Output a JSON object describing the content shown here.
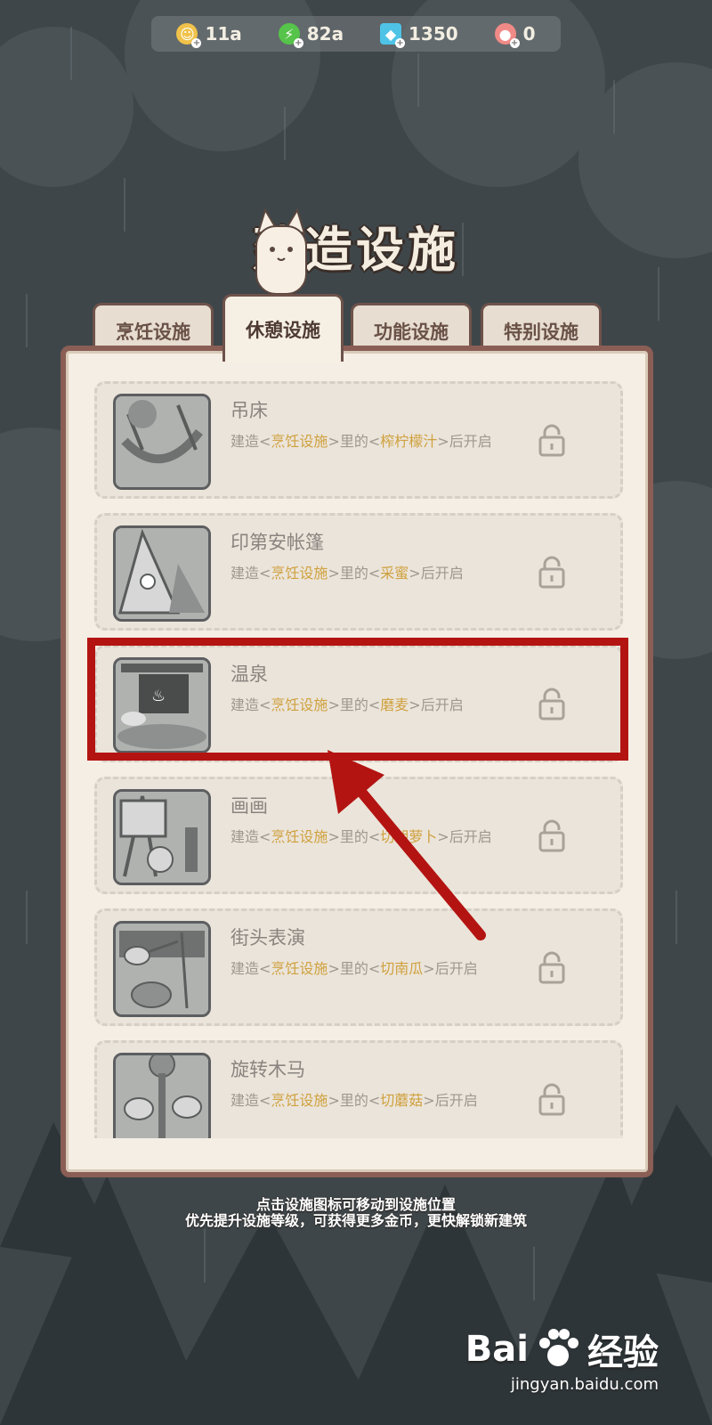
{
  "currencies": [
    {
      "icon": "coin-icon",
      "value": "11a",
      "color": "#f0c24a"
    },
    {
      "icon": "energy-icon",
      "value": "82a",
      "color": "#56c44a"
    },
    {
      "icon": "diamond-icon",
      "value": "1350",
      "color": "#4fc3e6"
    },
    {
      "icon": "donut-icon",
      "value": "0",
      "color": "#f08a86"
    }
  ],
  "title": "建造设施",
  "tabs": [
    {
      "label": "烹饪设施",
      "active": false
    },
    {
      "label": "休憩设施",
      "active": true
    },
    {
      "label": "功能设施",
      "active": false
    },
    {
      "label": "特别设施",
      "active": false
    }
  ],
  "facilities": [
    {
      "name": "吊床",
      "pre": "建造<",
      "category": "烹饪设施",
      "mid": ">里的<",
      "requirement": "榨柠檬汁",
      "post": ">后开启",
      "locked": true
    },
    {
      "name": "印第安帐篷",
      "pre": "建造<",
      "category": "烹饪设施",
      "mid": ">里的<",
      "requirement": "采蜜",
      "post": ">后开启",
      "locked": true
    },
    {
      "name": "温泉",
      "pre": "建造<",
      "category": "烹饪设施",
      "mid": ">里的<",
      "requirement": "磨麦",
      "post": ">后开启",
      "locked": true
    },
    {
      "name": "画画",
      "pre": "建造<",
      "category": "烹饪设施",
      "mid": ">里的<",
      "requirement": "切胡萝卜",
      "post": ">后开启",
      "locked": true
    },
    {
      "name": "街头表演",
      "pre": "建造<",
      "category": "烹饪设施",
      "mid": ">里的<",
      "requirement": "切南瓜",
      "post": ">后开启",
      "locked": true
    },
    {
      "name": "旋转木马",
      "pre": "建造<",
      "category": "烹饪设施",
      "mid": ">里的<",
      "requirement": "切蘑菇",
      "post": ">后开启",
      "locked": true
    }
  ],
  "tips": [
    "点击设施图标可移动到设施位置",
    "优先提升设施等级，可获得更多金币，更快解锁新建筑"
  ],
  "watermark": {
    "brand": "Bai",
    "brand2": "经验",
    "url": "jingyan.baidu.com"
  },
  "colors": {
    "highlight": "#b31412",
    "panel_border": "#8a5e55",
    "requirement_text": "#cfa13e"
  }
}
